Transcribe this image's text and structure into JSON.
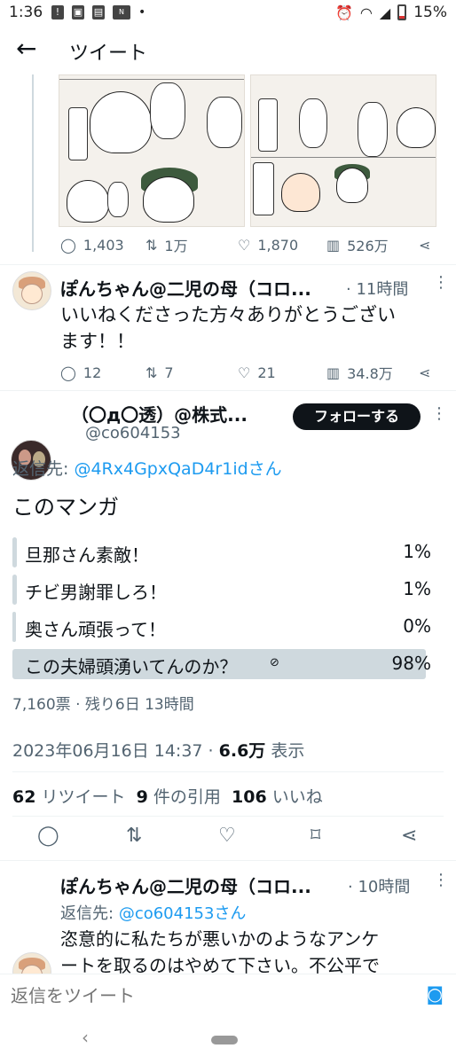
{
  "status_bar": {
    "time": "1:36",
    "battery": "15%"
  },
  "header": {
    "title": "ツイート"
  },
  "tweet1": {
    "replies": "1,403",
    "retweets": "1万",
    "likes": "1,870",
    "views": "526万"
  },
  "tweet2": {
    "name": "ぽんちゃん@二児の母（コロ...",
    "time": "· 11時間",
    "text_line1": "いいねくださった方々ありがとうござい",
    "text_line2": "ます！！",
    "replies": "12",
    "retweets": "7",
    "likes": "21",
    "views": "34.8万"
  },
  "main_tweet": {
    "name": "（〇д〇透）@株式...",
    "handle": "@co604153",
    "follow_label": "フォローする",
    "reply_to_label": "返信先:",
    "reply_to_handle": "@4Rx4GpxQaD4r1idさん",
    "text": "このマンガ",
    "poll": [
      {
        "label": "旦那さん素敵！",
        "percent": "1%",
        "fill": 0.01
      },
      {
        "label": "チビ男謝罪しろ！",
        "percent": "1%",
        "fill": 0.01
      },
      {
        "label": "奥さん頑張って！",
        "percent": "0%",
        "fill": 0
      },
      {
        "label": "この夫婦頭湧いてんのか？",
        "percent": "98%",
        "fill": 0.98
      }
    ],
    "poll_meta": "7,160票 · 残り6日 13時間",
    "timestamp": "2023年06月16日 14:37 ·",
    "views_count": "6.6万",
    "views_label": "表示",
    "retweets_count": "62",
    "retweets_label": "リツイート",
    "quotes_count": "9",
    "quotes_label": "件の引用",
    "likes_count": "106",
    "likes_label": "いいね"
  },
  "reply_tweet": {
    "name": "ぽんちゃん@二児の母（コロ...",
    "time": "· 10時間",
    "reply_to_label": "返信先:",
    "reply_to_handle": "@co604153さん",
    "text_line1": "恣意的に私たちが悪いかのようなアンケ",
    "text_line2": "ートを取るのはやめて下さい。不公平で"
  },
  "reply_bar": {
    "placeholder": "返信をツイート"
  },
  "colors": {
    "accent": "#1d9bf0",
    "poll_fill": "#cfd9de",
    "text": "#0f1419",
    "muted": "#536471"
  }
}
